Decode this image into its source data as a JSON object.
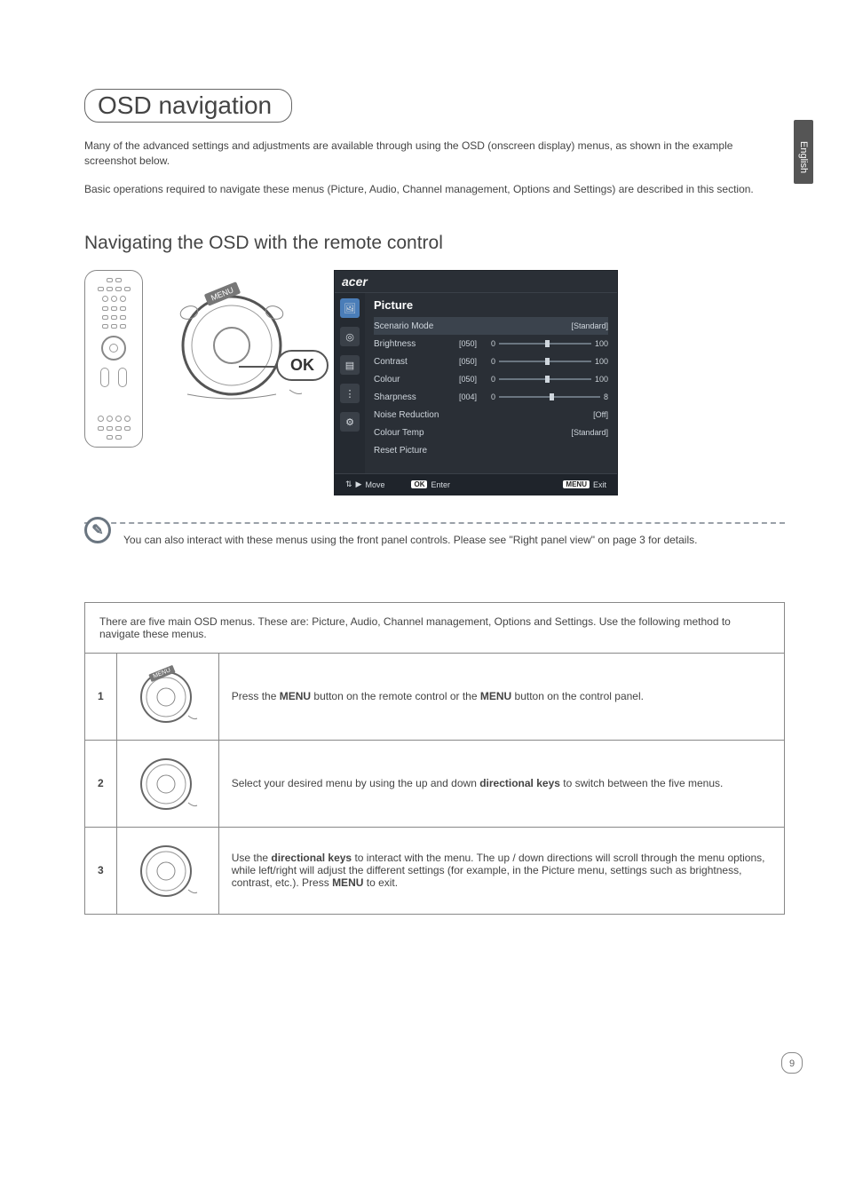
{
  "sidebar_language": "English",
  "page_number": "9",
  "title": "OSD navigation",
  "intro_p1": "Many of the advanced settings and adjustments are available through using the OSD (onscreen display) menus, as shown in the example screenshot below.",
  "intro_p2": "Basic operations required to navigate these menus (Picture, Audio, Channel management, Options and Settings) are described in this section.",
  "subhead": "Navigating the OSD with the remote control",
  "menu_tag": "MENU",
  "ok_label": "OK",
  "osd": {
    "brand": "acer",
    "title": "Picture",
    "rows": [
      {
        "label": "Scenario Mode",
        "value": "",
        "text": "[Standard]",
        "slider": false,
        "sel": true
      },
      {
        "label": "Brightness",
        "value": "[050]",
        "min": "0",
        "max": "100",
        "pos": 50,
        "slider": true
      },
      {
        "label": "Contrast",
        "value": "[050]",
        "min": "0",
        "max": "100",
        "pos": 50,
        "slider": true
      },
      {
        "label": "Colour",
        "value": "[050]",
        "min": "0",
        "max": "100",
        "pos": 50,
        "slider": true
      },
      {
        "label": "Sharpness",
        "value": "[004]",
        "min": "0",
        "max": "8",
        "pos": 50,
        "slider": true
      },
      {
        "label": "Noise Reduction",
        "value": "",
        "text": "[Off]",
        "slider": false
      },
      {
        "label": "Colour Temp",
        "value": "",
        "text": "[Standard]",
        "slider": false
      },
      {
        "label": "Reset Picture",
        "value": "",
        "text": "",
        "slider": false
      }
    ],
    "footer": {
      "move_label": "Move",
      "enter_key": "OK",
      "enter_label": "Enter",
      "exit_key": "MENU",
      "exit_label": "Exit"
    }
  },
  "note_text": "You can also interact with these menus using the front panel controls. Please see \"Right panel view\" on page 3 for details.",
  "steps_intro": "There are five main OSD menus. These are: Picture, Audio, Channel management, Options and Settings. Use the following method to navigate these menus.",
  "steps": [
    {
      "n": "1",
      "pre": "Press the ",
      "b1": "MENU",
      "mid": " button on the remote control or the ",
      "b2": "MENU",
      "post": " button on the control panel."
    },
    {
      "n": "2",
      "pre": "Select your desired menu by using the up and down ",
      "b1": "directional keys",
      "mid": " to switch between the five menus.",
      "b2": "",
      "post": ""
    },
    {
      "n": "3",
      "pre": "Use the ",
      "b1": "directional keys",
      "mid": " to interact with the menu. The up / down directions will scroll through the menu options, while left/right will adjust the different settings (for example, in the Picture menu, settings such as brightness, contrast, etc.). Press ",
      "b2": "MENU",
      "post": " to exit."
    }
  ]
}
